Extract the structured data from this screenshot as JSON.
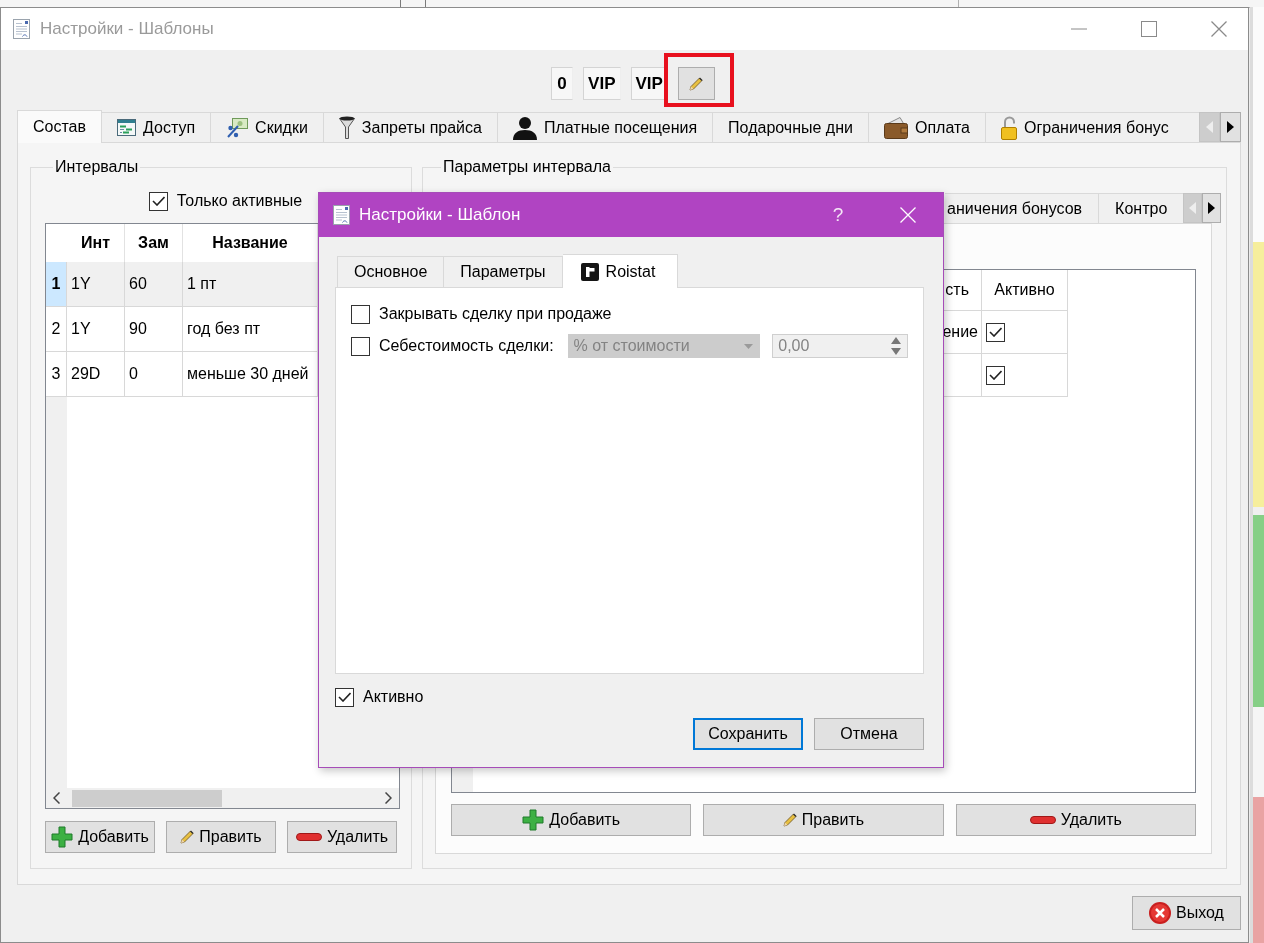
{
  "window": {
    "title": "Настройки - Шаблоны"
  },
  "toolbar": {
    "labels": [
      "0",
      "VIP",
      "VIP"
    ],
    "edit_button": {
      "highlighted": true
    }
  },
  "tabs": [
    {
      "label": "Состав",
      "selected": true
    },
    {
      "label": "Доступ",
      "selected": false
    },
    {
      "label": "Скидки",
      "selected": false
    },
    {
      "label": "Запреты прайса",
      "selected": false
    },
    {
      "label": "Платные посещения",
      "selected": false
    },
    {
      "label": "Подарочные дни",
      "selected": false
    },
    {
      "label": "Оплата",
      "selected": false
    },
    {
      "label": "Ограничения бонус",
      "selected": false
    }
  ],
  "tab_scroll": {
    "left_disabled": true,
    "right_disabled": false
  },
  "intervals": {
    "title": "Интервалы",
    "only_active": {
      "label": "Только активные",
      "checked": true
    },
    "table": {
      "columns": [
        "Инт",
        "Зам",
        "Название"
      ],
      "rows": [
        {
          "number": "1",
          "selected": true,
          "cells": [
            "1Y",
            "60",
            "1 пт"
          ]
        },
        {
          "number": "2",
          "selected": false,
          "cells": [
            "1Y",
            "90",
            "год без пт"
          ]
        },
        {
          "number": "3",
          "selected": false,
          "cells": [
            "29D",
            "0",
            "меньше 30 дней"
          ]
        }
      ]
    },
    "buttons": [
      "Добавить",
      "Править",
      "Удалить"
    ]
  },
  "interval_params": {
    "title": "Параметры интервала",
    "tabs": [
      {
        "label": "аничения бонусов",
        "selected": false
      },
      {
        "label": "Контро",
        "selected": false
      }
    ],
    "tab_scroll": {
      "left_disabled": true,
      "right_disabled": false
    },
    "table": {
      "columns": [
        "сть",
        "Активно"
      ],
      "rows": [
        {
          "cell": "ение",
          "active": true
        },
        {
          "active": true
        }
      ]
    },
    "buttons": [
      "Добавить",
      "Править",
      "Удалить"
    ]
  },
  "exit_button": "Выход",
  "dialog": {
    "title": "Настройки - Шаблон",
    "help": "?",
    "tabs": [
      {
        "label": "Основное",
        "selected": false
      },
      {
        "label": "Параметры",
        "selected": false
      },
      {
        "label": "Roistat",
        "selected": true
      }
    ],
    "options": [
      {
        "kind": "checkbox",
        "label": "Закрывать сделку при продаже",
        "checked": false
      },
      {
        "kind": "cost",
        "label": "Себестоимость сделки:",
        "checked": false,
        "mode": {
          "value": "% от стоимости",
          "disabled": true
        },
        "amount": {
          "value": "0,00",
          "disabled": true
        }
      }
    ],
    "active": {
      "label": "Активно",
      "checked": true
    },
    "buttons": [
      {
        "label": "Сохранить",
        "default": true
      },
      {
        "label": "Отмена",
        "default": false
      }
    ]
  }
}
